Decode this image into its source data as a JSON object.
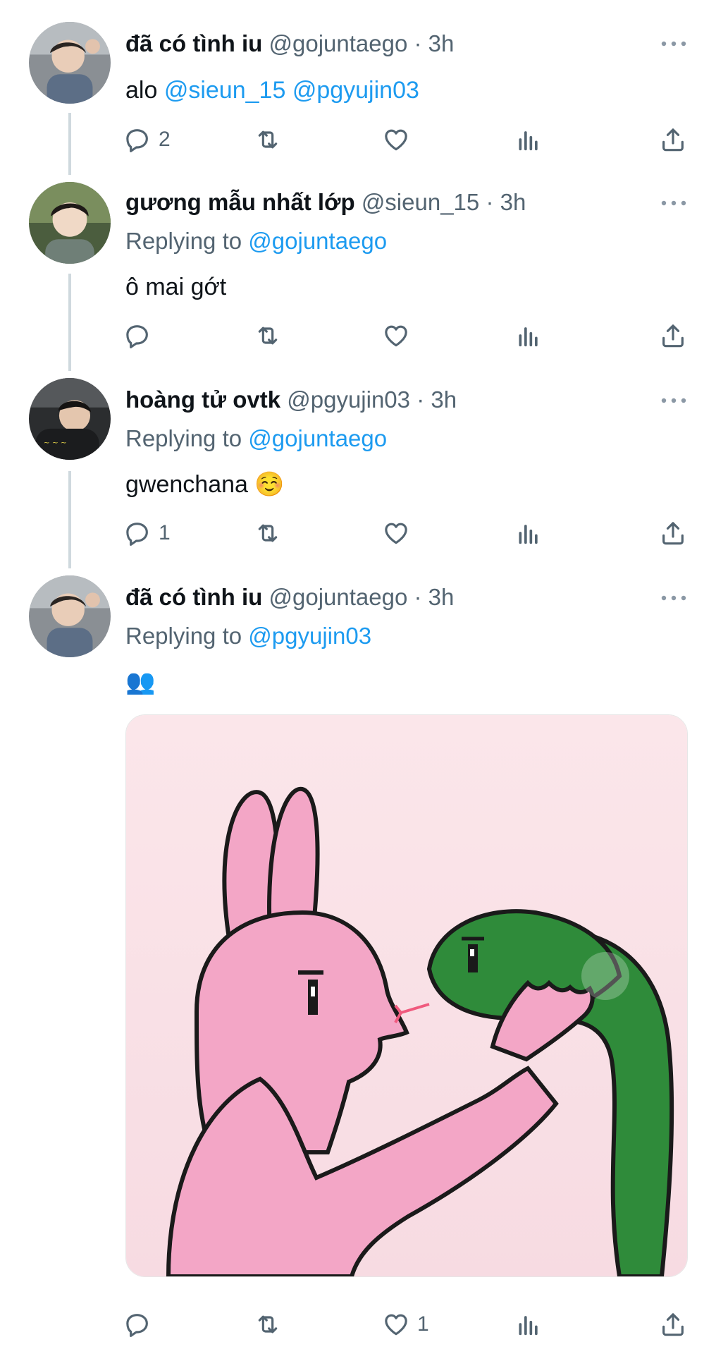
{
  "tweets": [
    {
      "name": "đã có tình iu",
      "handle": "@gojuntaego",
      "dot": "·",
      "time": "3h",
      "text_prefix": "alo",
      "mention1": "@sieun_15",
      "mention2": "@pgyujin03",
      "reply_count": "2",
      "like_count": ""
    },
    {
      "name": "gương mẫu nhất lớp",
      "handle": "@sieun_15",
      "dot": "·",
      "time": "3h",
      "replying_label": "Replying to",
      "replying_to": "@gojuntaego",
      "text": "ô mai gớt",
      "reply_count": ""
    },
    {
      "name": "hoàng tử ovtk",
      "handle": "@pgyujin03",
      "dot": "·",
      "time": "3h",
      "replying_label": "Replying to",
      "replying_to": "@gojuntaego",
      "text": "gwenchana ☺️",
      "reply_count": "1"
    },
    {
      "name": "đã có tình iu",
      "handle": "@gojuntaego",
      "dot": "·",
      "time": "3h",
      "replying_label": "Replying to",
      "replying_to": "@pgyujin03",
      "text": "👥",
      "reply_count": "",
      "like_count": "1"
    }
  ],
  "icons": {
    "reply": "reply-icon",
    "retweet": "retweet-icon",
    "like": "heart-icon",
    "views": "views-icon",
    "share": "share-icon",
    "more": "more-icon"
  },
  "colors": {
    "mention": "#1d9bf0",
    "secondary": "#536471",
    "thread_line": "#cfd9de"
  }
}
